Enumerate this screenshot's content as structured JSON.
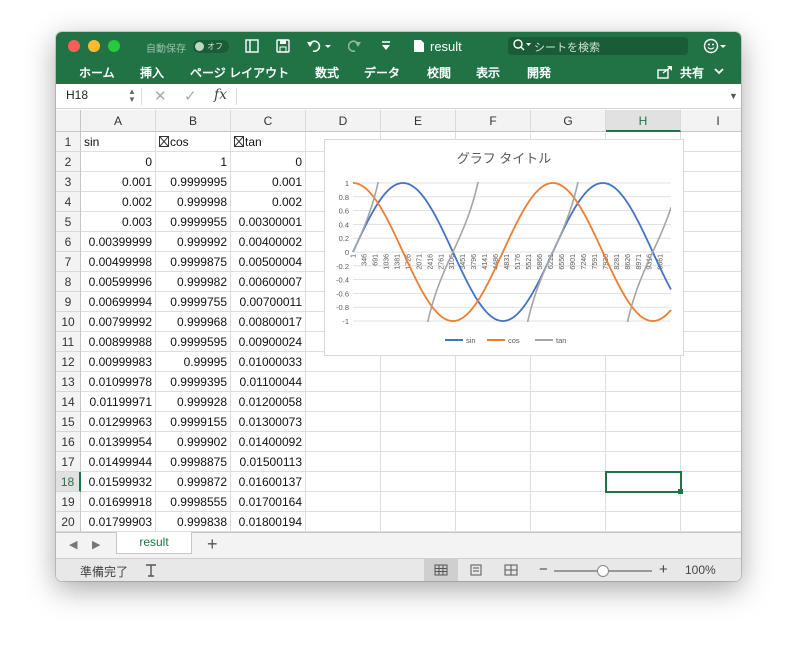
{
  "titlebar": {
    "autosave_label": "自動保存",
    "autosave_state": "オフ",
    "doc_title": "result",
    "search_placeholder": "シートを検索"
  },
  "ribbon_tabs": [
    "ホーム",
    "挿入",
    "ページ レイアウト",
    "数式",
    "データ",
    "校閲",
    "表示",
    "開発"
  ],
  "share_label": "共有",
  "formula_bar": {
    "name_box": "H18",
    "fx": "fx",
    "content": ""
  },
  "columns": [
    "A",
    "B",
    "C",
    "D",
    "E",
    "F",
    "G",
    "H",
    "I"
  ],
  "selected_cell": "H18",
  "rows": [
    {
      "n": "1",
      "a": "sin",
      "b": "cos",
      "c": "tan"
    },
    {
      "n": "2",
      "a": "0",
      "b": "1",
      "c": "0"
    },
    {
      "n": "3",
      "a": "0.001",
      "b": "0.9999995",
      "c": "0.001"
    },
    {
      "n": "4",
      "a": "0.002",
      "b": "0.999998",
      "c": "0.002"
    },
    {
      "n": "5",
      "a": "0.003",
      "b": "0.9999955",
      "c": "0.00300001"
    },
    {
      "n": "6",
      "a": "0.00399999",
      "b": "0.999992",
      "c": "0.00400002"
    },
    {
      "n": "7",
      "a": "0.00499998",
      "b": "0.9999875",
      "c": "0.00500004"
    },
    {
      "n": "8",
      "a": "0.00599996",
      "b": "0.999982",
      "c": "0.00600007"
    },
    {
      "n": "9",
      "a": "0.00699994",
      "b": "0.9999755",
      "c": "0.00700011"
    },
    {
      "n": "10",
      "a": "0.00799992",
      "b": "0.999968",
      "c": "0.00800017"
    },
    {
      "n": "11",
      "a": "0.00899988",
      "b": "0.9999595",
      "c": "0.00900024"
    },
    {
      "n": "12",
      "a": "0.00999983",
      "b": "0.99995",
      "c": "0.01000033"
    },
    {
      "n": "13",
      "a": "0.01099978",
      "b": "0.9999395",
      "c": "0.01100044"
    },
    {
      "n": "14",
      "a": "0.01199971",
      "b": "0.999928",
      "c": "0.01200058"
    },
    {
      "n": "15",
      "a": "0.01299963",
      "b": "0.9999155",
      "c": "0.01300073"
    },
    {
      "n": "16",
      "a": "0.01399954",
      "b": "0.999902",
      "c": "0.01400092"
    },
    {
      "n": "17",
      "a": "0.01499944",
      "b": "0.9998875",
      "c": "0.01500113"
    },
    {
      "n": "18",
      "a": "0.01599932",
      "b": "0.999872",
      "c": "0.01600137"
    },
    {
      "n": "19",
      "a": "0.01699918",
      "b": "0.9998555",
      "c": "0.01700164"
    },
    {
      "n": "20",
      "a": "0.01799903",
      "b": "0.999838",
      "c": "0.01800194"
    }
  ],
  "chart_data": {
    "type": "line",
    "title": "グラフ タイトル",
    "ylim": [
      -1,
      1
    ],
    "yticks": [
      "1",
      "0.8",
      "0.6",
      "0.4",
      "0.2",
      "0",
      "-0.2",
      "-0.4",
      "-0.6",
      "-0.8",
      "-1"
    ],
    "xticks": [
      "1",
      "346",
      "691",
      "1036",
      "1381",
      "1726",
      "2071",
      "2416",
      "2761",
      "3106",
      "3451",
      "3796",
      "4141",
      "4486",
      "4831",
      "5176",
      "5521",
      "5866",
      "6211",
      "6556",
      "6901",
      "7246",
      "7591",
      "7936",
      "8281",
      "8626",
      "8971",
      "9316",
      "9661"
    ],
    "x_range": [
      1,
      10000
    ],
    "x_step": 0.001,
    "legend_position": "bottom",
    "series": [
      {
        "name": "sin",
        "color": "#4472c4"
      },
      {
        "name": "cos",
        "color": "#ed7d31"
      },
      {
        "name": "tan",
        "color": "#a5a5a5"
      }
    ]
  },
  "sheet_tab": "result",
  "status": {
    "ready": "準備完了",
    "zoom": "100%"
  },
  "icon_names": [
    "close-window-icon",
    "minimize-window-icon",
    "zoom-window-icon",
    "sidebar-icon",
    "save-icon",
    "undo-icon",
    "redo-icon",
    "customize-icon",
    "document-icon",
    "search-icon",
    "smiley-icon",
    "share-icon",
    "chevron-down-icon",
    "cancel-icon",
    "confirm-icon",
    "function-icon",
    "prev-sheet-icon",
    "next-sheet-icon",
    "add-sheet-icon",
    "normal-view-icon",
    "page-layout-icon",
    "page-break-icon"
  ]
}
